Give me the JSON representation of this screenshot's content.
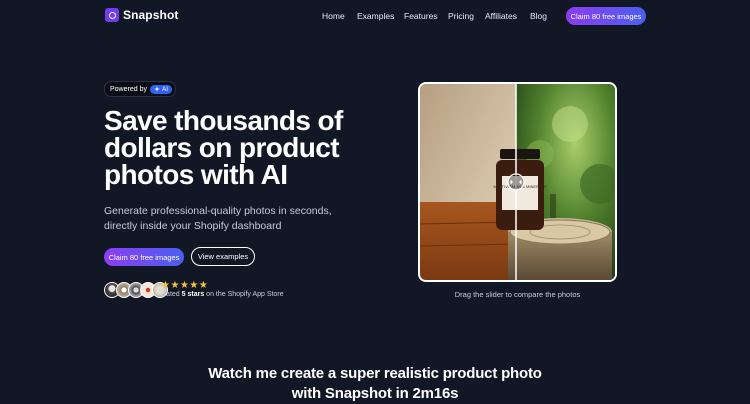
{
  "brand": {
    "name": "Snapshot"
  },
  "nav": {
    "items": [
      "Home",
      "Examples",
      "Features",
      "Pricing",
      "Affiliates",
      "Blog"
    ],
    "cta": "Claim 80 free images"
  },
  "hero": {
    "badge_text": "Powered by",
    "badge_ai": "AI",
    "title": "Save thousands of dollars on product photos with AI",
    "subtitle": "Generate professional-quality photos in seconds, directly inside your Shopify dashboard",
    "primary_cta": "Claim 80 free images",
    "secondary_cta": "View examples",
    "rating": {
      "stars": 5,
      "prefix": "Rated",
      "value": "5 stars",
      "suffix": "on the Shopify App Store"
    }
  },
  "compare": {
    "caption": "Drag the slider to compare the photos",
    "product_label": "MULTIVITAMIN & MINERALS",
    "slider_position": 0.49
  },
  "watch": {
    "title_line1": "Watch me create a super realistic product photo",
    "title_line2": "with Snapshot in 2m16s"
  },
  "colors": {
    "background": "#121725",
    "accent_start": "#8b3df3",
    "accent_end": "#4b5ff0",
    "star": "#f6c13d"
  }
}
